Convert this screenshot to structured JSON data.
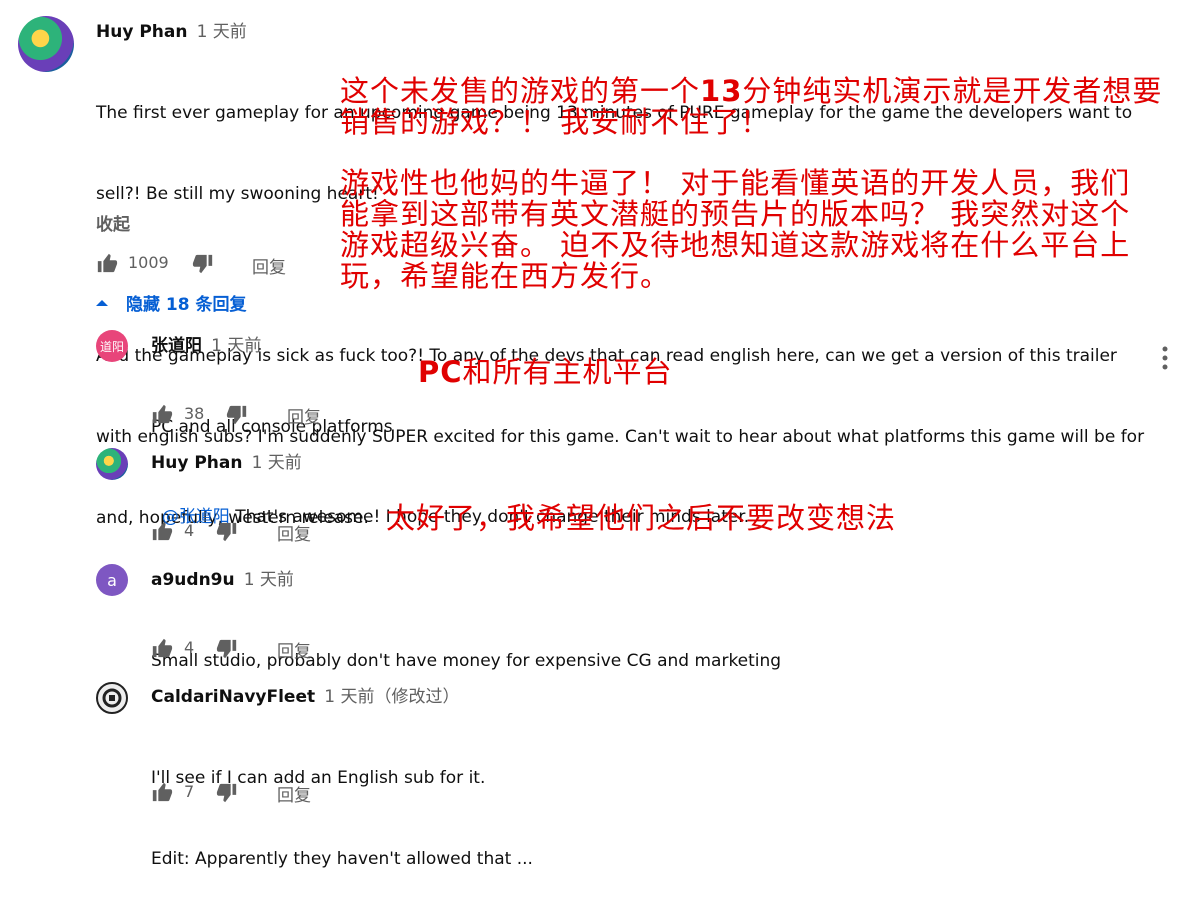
{
  "main_comment": {
    "author": "Huy Phan",
    "time": "1 天前",
    "lines": [
      "The first ever gameplay for an upcoming game being 13 minutes of PURE gameplay for the game the developers want to",
      "sell?! Be still my swooning heart!",
      "",
      "And the gameplay is sick as fuck too?! To any of the devs that can read english here, can we get a version of this trailer",
      "with english subs? I'm suddenly SUPER excited for this game. Can't wait to hear about what platforms this game will be for",
      "and, hopefully, western release."
    ],
    "collapse_label": "收起",
    "likes": "1009",
    "reply_label": "回复"
  },
  "replies_toggle": {
    "label": "隐藏 18 条回复",
    "icon": "caret-up-icon"
  },
  "replies": [
    {
      "author": "张道阳",
      "time": "1 天前",
      "avatar_text": "道阳",
      "avatar_color": "#e8457a",
      "mention": "",
      "lines": [
        "PC and all console platforms"
      ],
      "likes": "38",
      "reply_label": "回复"
    },
    {
      "author": "Huy Phan",
      "time": "1 天前",
      "avatar_text": "",
      "avatar_color": "#3aa36b",
      "mention": "@张道阳",
      "lines": [
        " That's awesome! I hope they don't change their minds later."
      ],
      "likes": "4",
      "reply_label": "回复"
    },
    {
      "author": "a9udn9u",
      "time": "1 天前",
      "avatar_text": "a",
      "avatar_color": "#7e57c2",
      "mention": "",
      "lines": [
        "Small studio, probably don't have money for expensive CG and marketing"
      ],
      "likes": "4",
      "reply_label": "回复"
    },
    {
      "author": "CaldariNavyFleet",
      "time": "1 天前（修改过）",
      "avatar_text": "",
      "avatar_color": "#222222",
      "mention": "",
      "lines": [
        "I'll see if I can add an English sub for it.",
        "Edit: Apparently they haven't allowed that ..."
      ],
      "likes": "7",
      "reply_label": "回复"
    }
  ],
  "overlays": {
    "t1_l1_a": "这个未发售的游戏的第一个",
    "t1_l1_b": "13",
    "t1_l1_c": "分钟纯实机演示就是开发者想要",
    "t1_l2": "销售的游戏？！ 我安耐不住了！",
    "t2_l1": "游戏性也他妈的牛逼了！ 对于能看懂英语的开发人员，我们",
    "t2_l2": "能拿到这部带有英文潜艇的预告片的版本吗？ 我突然对这个",
    "t2_l3": "游戏超级兴奋。 迫不及待地想知道这款游戏将在什么平台上",
    "t2_l4": "玩，希望能在西方发行。",
    "t3_a": "PC",
    "t3_b": "和所有主机平台",
    "t4": "太好了，我希望他们之后不要改变想法"
  },
  "colors": {
    "overlay_red": "#e00000",
    "link_blue": "#065fd4",
    "muted": "#606060"
  }
}
